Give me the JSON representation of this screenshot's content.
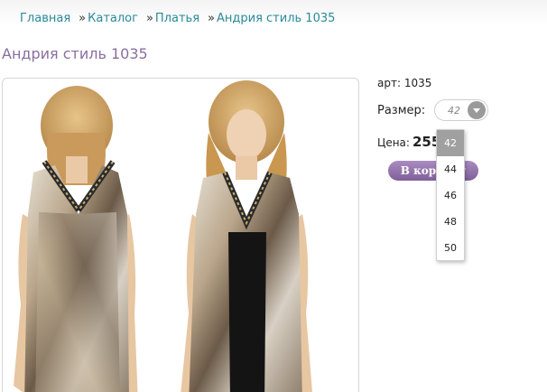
{
  "breadcrumb": {
    "items": [
      "Главная",
      "Каталог",
      "Платья",
      "Андрия стиль 1035"
    ],
    "separator": "»"
  },
  "product": {
    "title": "Андрия стиль 1035",
    "sku": "арт: 1035",
    "size_label": "Размер:",
    "size_selected": "42",
    "price_label": "Цена:",
    "price_value": "255",
    "price_suffix": ".",
    "cart_button": "В корзину"
  },
  "size_options": [
    "42",
    "44",
    "46",
    "48",
    "50"
  ],
  "colors": {
    "link": "#2a8a9a",
    "title": "#8a6ea0",
    "button": "#8f70a8",
    "selected_option": "#a0a0a0"
  }
}
